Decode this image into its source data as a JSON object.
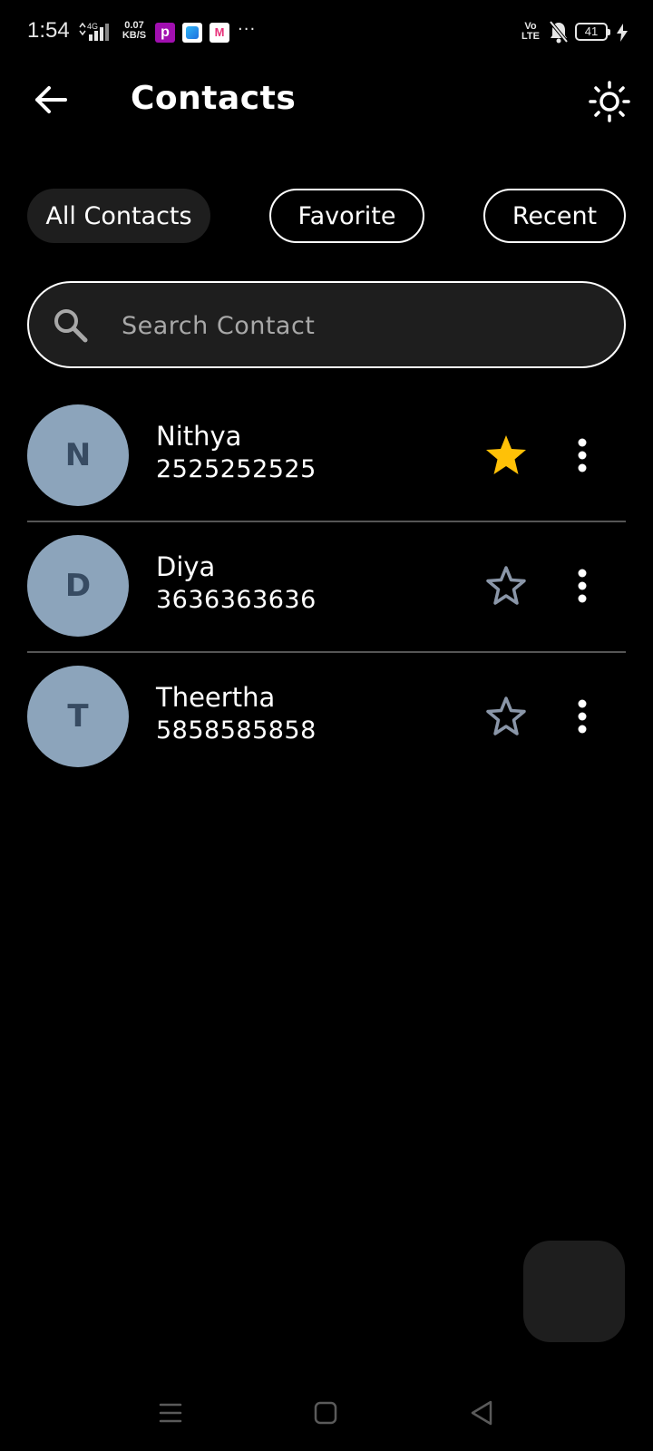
{
  "status_bar": {
    "time": "1:54",
    "network": "4G",
    "speed_value": "0.07",
    "speed_unit": "KB/S",
    "app_p": "p",
    "app_m": "M",
    "more": "···",
    "volte_top": "Vo",
    "volte_bottom": "LTE",
    "battery": "41"
  },
  "header": {
    "title": "Contacts"
  },
  "filters": {
    "all": "All Contacts",
    "favorite": "Favorite",
    "recent": "Recent",
    "selected": "All Contacts"
  },
  "search": {
    "placeholder": "Search Contact",
    "value": ""
  },
  "contacts": [
    {
      "initial": "N",
      "name": "Nithya",
      "phone": "2525252525",
      "favorite": true
    },
    {
      "initial": "D",
      "name": "Diya",
      "phone": "3636363636",
      "favorite": false
    },
    {
      "initial": "T",
      "name": "Theertha",
      "phone": "5858585858",
      "favorite": false
    }
  ],
  "colors": {
    "background": "#000000",
    "surface": "#1e1e1e",
    "avatar_bg": "#8ca4bb",
    "avatar_text": "#374b62",
    "star_active": "#ffc107",
    "star_inactive": "#8a96a8",
    "divider": "#555555"
  },
  "icons": {
    "back": "arrow-left-icon",
    "theme": "sun-icon",
    "search": "search-icon",
    "favorite": "star-icon",
    "menu": "more-vert-icon"
  }
}
